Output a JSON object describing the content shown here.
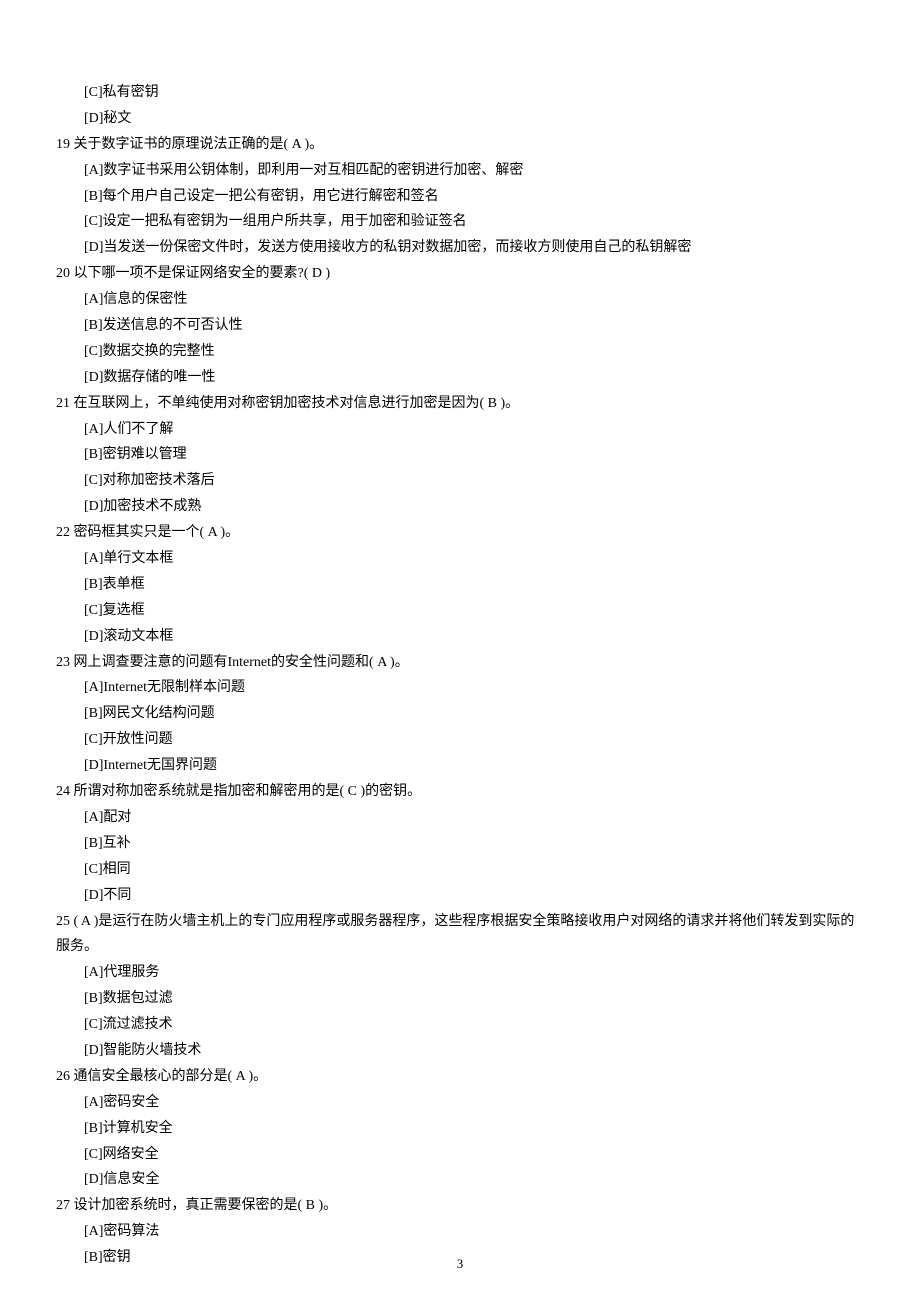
{
  "prev_tail": {
    "optC": "[C]私有密钥",
    "optD": "[D]秘文"
  },
  "q19": {
    "text": "19 关于数字证书的原理说法正确的是( A )。",
    "A": "[A]数字证书采用公钥体制，即利用一对互相匹配的密钥进行加密、解密",
    "B": "[B]每个用户自己设定一把公有密钥，用它进行解密和签名",
    "C": "[C]设定一把私有密钥为一组用户所共享，用于加密和验证签名",
    "D": "[D]当发送一份保密文件时，发送方使用接收方的私钥对数据加密，而接收方则使用自己的私钥解密"
  },
  "q20": {
    "text": "20 以下哪一项不是保证网络安全的要素?( D )",
    "A": "[A]信息的保密性",
    "B": "[B]发送信息的不可否认性",
    "C": "[C]数据交换的完整性",
    "D": "[D]数据存储的唯一性"
  },
  "q21": {
    "text": "21 在互联网上，不单纯使用对称密钥加密技术对信息进行加密是因为( B )。",
    "A": "[A]人们不了解",
    "B": "[B]密钥难以管理",
    "C": "[C]对称加密技术落后",
    "D": "[D]加密技术不成熟"
  },
  "q22": {
    "text": "22 密码框其实只是一个( A )。",
    "A": "[A]单行文本框",
    "B": "[B]表单框",
    "C": "[C]复选框",
    "D": "[D]滚动文本框"
  },
  "q23": {
    "text": "23 网上调查要注意的问题有Internet的安全性问题和( A )。",
    "A": "[A]Internet无限制样本问题",
    "B": "[B]网民文化结构问题",
    "C": "[C]开放性问题",
    "D": "[D]Internet无国界问题"
  },
  "q24": {
    "text": "24 所谓对称加密系统就是指加密和解密用的是( C )的密钥。",
    "A": "[A]配对",
    "B": "[B]互补",
    "C": "[C]相同",
    "D": "[D]不同"
  },
  "q25": {
    "text": "25 ( A )是运行在防火墙主机上的专门应用程序或服务器程序，这些程序根据安全策略接收用户对网络的请求并将他们转发到实际的服务。",
    "A": "[A]代理服务",
    "B": "[B]数据包过滤",
    "C": "[C]流过滤技术",
    "D": "[D]智能防火墙技术"
  },
  "q26": {
    "text": "26 通信安全最核心的部分是( A )。",
    "A": "[A]密码安全",
    "B": "[B]计算机安全",
    "C": "[C]网络安全",
    "D": "[D]信息安全"
  },
  "q27": {
    "text": "27 设计加密系统时，真正需要保密的是( B )。",
    "A": "[A]密码算法",
    "B": "[B]密钥"
  },
  "page_number": "3"
}
